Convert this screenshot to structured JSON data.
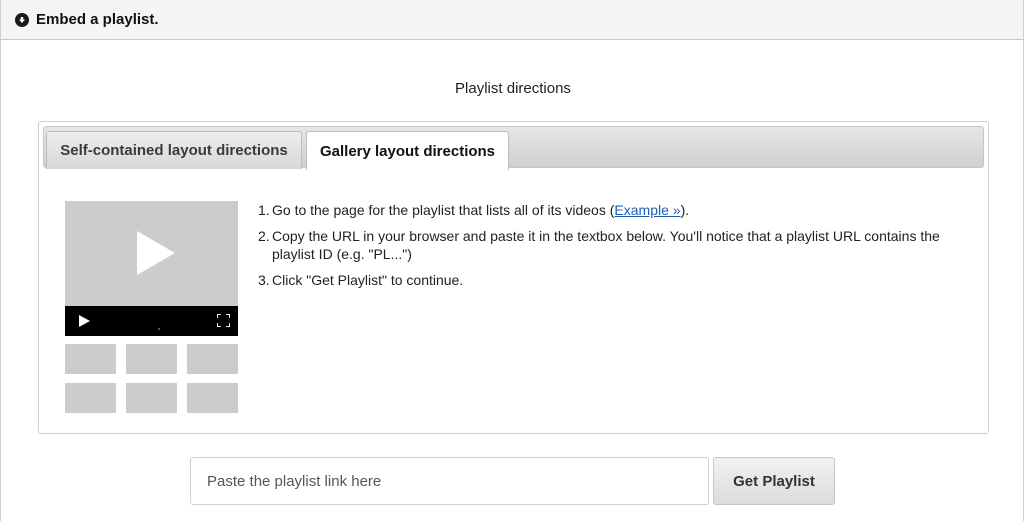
{
  "panel": {
    "title": "Embed a playlist.",
    "toggle_icon": "circle-arrow-down-icon"
  },
  "section_title": "Playlist directions",
  "tabs": [
    {
      "label": "Self-contained layout directions",
      "active": false
    },
    {
      "label": "Gallery layout directions",
      "active": true
    }
  ],
  "mock_icons": {
    "big_play": "play-icon",
    "small_play": "play-icon",
    "fullscreen": "fullscreen-icon"
  },
  "steps": [
    {
      "number": "1.",
      "text_before": "Go to the page for the playlist that lists all of its videos (",
      "link": "Example »",
      "text_after": ")."
    },
    {
      "number": "2.",
      "text": "Copy the URL in your browser and paste it in the textbox below. You'll notice that a playlist URL contains the playlist ID (e.g. \"PL...\")"
    },
    {
      "number": "3.",
      "text": "Click \"Get Playlist\" to continue."
    }
  ],
  "playlist_input": {
    "placeholder": "Paste the playlist link here",
    "value": ""
  },
  "get_button_label": "Get Playlist",
  "colors": {
    "link": "#1a5fb4",
    "mock_gray": "#cccccc",
    "mock_bar": "#000000"
  }
}
